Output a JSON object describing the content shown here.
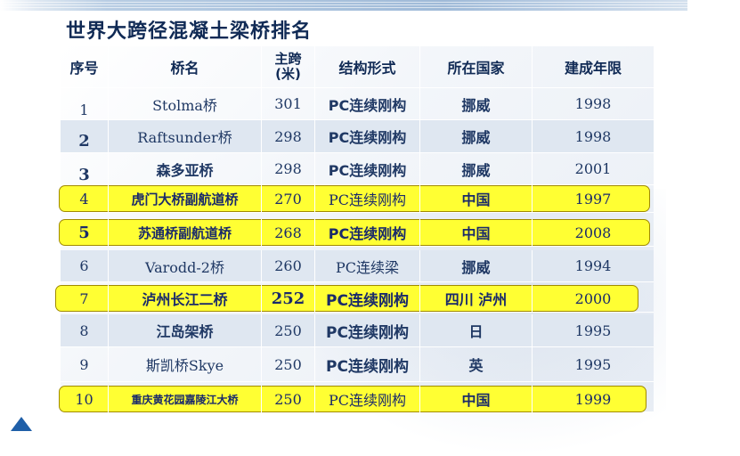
{
  "title": "世界大跨径混凝土梁桥排名",
  "headers": {
    "index": "序号",
    "name": "桥名",
    "span_line1": "主跨",
    "span_line2": "(米)",
    "structure": "结构形式",
    "country": "所在国家",
    "year": "建成年限"
  },
  "rows": [
    {
      "index": "1",
      "name": "Stolma桥",
      "span": "301",
      "structure": "PC连续刚构",
      "country": "挪威",
      "year": "1998",
      "highlight": false
    },
    {
      "index": "2",
      "name": "Raftsunder桥",
      "span": "298",
      "structure": "PC连续刚构",
      "country": "挪威",
      "year": "1998",
      "highlight": false
    },
    {
      "index": "3",
      "name": "森多亚桥",
      "span": "298",
      "structure": "PC连续刚构",
      "country": "挪威",
      "year": "2001",
      "highlight": false
    },
    {
      "index": "4",
      "name": "虎门大桥副航道桥",
      "span": "270",
      "structure": "PC连续刚构",
      "country": "中国",
      "year": "1997",
      "highlight": true
    },
    {
      "index": "5",
      "name": "苏通桥副航道桥",
      "span": "268",
      "structure": "PC连续刚构",
      "country": "中国",
      "year": "2008",
      "highlight": true
    },
    {
      "index": "6",
      "name": "Varodd-2桥",
      "span": "260",
      "structure": "PC连续梁",
      "country": "挪威",
      "year": "1994",
      "highlight": false
    },
    {
      "index": "7",
      "name": "泸州长江二桥",
      "span": "252",
      "structure": "PC连续刚构",
      "country": "四川 泸州",
      "year": "2000",
      "highlight": true
    },
    {
      "index": "8",
      "name": "江岛架桥",
      "span": "250",
      "structure": "PC连续刚构",
      "country": "日",
      "year": "1995",
      "highlight": false
    },
    {
      "index": "9",
      "name": "斯凯桥Skye",
      "span": "250",
      "structure": "PC连续刚构",
      "country": "英",
      "year": "1995",
      "highlight": false
    },
    {
      "index": "10",
      "name": "重庆黄花园嘉陵江大桥",
      "span": "250",
      "structure": "PC连续刚构",
      "country": "中国",
      "year": "1999",
      "highlight": true
    }
  ],
  "colors": {
    "highlight": "#ffff33",
    "title": "#102a55",
    "text": "#1f3864",
    "accent": "#1f5fa8"
  }
}
